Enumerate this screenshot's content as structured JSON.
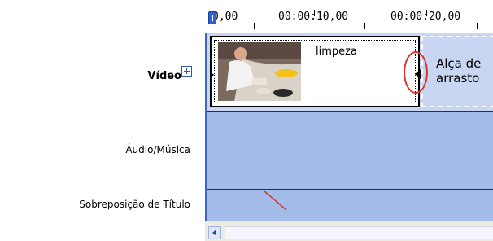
{
  "tracks": {
    "video_label": "Vídeo",
    "audio_label": "Áudio/Música",
    "title_label": "Sobreposição de Título"
  },
  "ruler": {
    "start": "0,00",
    "mark1": "00:00:10,00",
    "mark2": "00:00:20,00"
  },
  "clip": {
    "label": "limpeza"
  },
  "callout": {
    "line1": "Alça de",
    "line2": "arrasto"
  },
  "colors": {
    "track_background": "#a3bcea",
    "video_track": "#c9d6f2",
    "playhead": "#2f62d6",
    "highlight_circle": "#e0322d"
  },
  "icons": {
    "expand": "plus-box-icon",
    "scroll_left": "chevron-left-icon",
    "playhead": "playhead-marker-icon"
  }
}
